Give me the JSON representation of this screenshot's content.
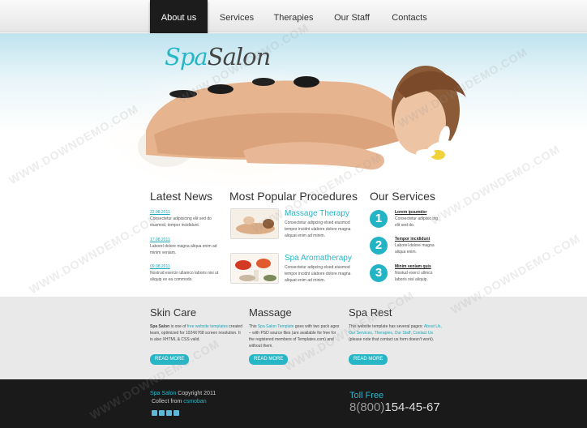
{
  "nav": {
    "items": [
      "About us",
      "Services",
      "Therapies",
      "Our Staff",
      "Contacts"
    ],
    "active": 0
  },
  "logo": {
    "part1": "Spa",
    "part2": "Salon"
  },
  "latest_news": {
    "title": "Latest News",
    "items": [
      {
        "date": "22.08.2011",
        "text": "Consectetur adipisicing elit sed do eiusmod, tempor incididunt."
      },
      {
        "date": "17.08.2011",
        "text": "Laborel dolore magna aliqua enim ad minim veniam."
      },
      {
        "date": "09.08.2011",
        "text": "Nostrud exercin ullamco laboris nisi ut aliquip ex ea commodo."
      }
    ]
  },
  "procedures": {
    "title": "Most Popular Procedures",
    "items": [
      {
        "title": "Massage Therapy",
        "text": "Consectetur adipcing elsed eiusmod tempor incidnt ulabore dolore magna aliquat enim ad minim."
      },
      {
        "title": "Spa Aromatherapy",
        "text": "Consectetur adipcing elsed eiusmod tempor incidnt ulabore dolore magna aliquat enim ad minim."
      }
    ]
  },
  "services": {
    "title": "Our Services",
    "items": [
      {
        "num": "1",
        "title": "Lorem ipsumdor",
        "text": "Consectetur adipisic ing elit sed do."
      },
      {
        "num": "2",
        "title": "Tempor incididunt",
        "text": "Laborel dolore magna aliqua enim."
      },
      {
        "num": "3",
        "title": "Minim veniam quis",
        "text": "Nostud exerci ullmco laboris nisl aliquip."
      }
    ]
  },
  "band": {
    "skin": {
      "title": "Skin Care",
      "brand": "Spa Salon",
      "t1": " is one of ",
      "link": "free website templates",
      "t2": " created team, optimized for 1024X768 screen resolution. It is also XHTML & CSS valid.",
      "button": "READ MORE"
    },
    "massage": {
      "title": "Massage",
      "t1": "This ",
      "link": "Spa Salon Template",
      "t2": " goes with two pack ages – with PSD source files (are available for free for the registered members of Templates.com) and without them.",
      "button": "READ MORE"
    },
    "rest": {
      "title": "Spa Rest",
      "t1": "This website template has several pages: ",
      "links": "About Us, Our Services, Therapies, Our Staff, Contact Us",
      "t2": " (please note that contact us form doesn't work).",
      "button": "READ MORE"
    }
  },
  "footer": {
    "brand": "Spa Salon",
    "copyright": " Copyright 2011",
    "collect": "Collect from ",
    "collect_link": "csmoban",
    "toll_label": "Toll Free",
    "toll_prefix": "8(800)",
    "toll_number": "154-45-67"
  },
  "watermark": "WWW.DOWNDEMO.COM",
  "colors": {
    "accent": "#27b6c6",
    "nav_active": "#1c1c1c",
    "footer": "#1a1a1a",
    "band": "#e9e9e9"
  }
}
